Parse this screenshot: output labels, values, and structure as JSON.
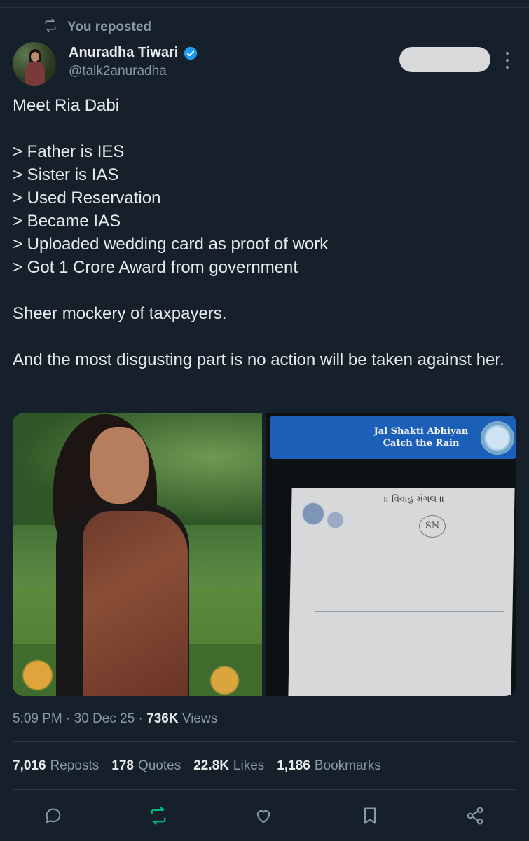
{
  "repost": {
    "label": "You reposted",
    "icon": "repost-icon"
  },
  "author": {
    "name": "Anuradha Tiwari",
    "handle": "@talk2anuradha",
    "verified": true,
    "badge_color": "#1d9bf0"
  },
  "tweet": {
    "paragraphs": [
      [
        "Meet Ria Dabi"
      ],
      [
        "> Father is IES",
        "> Sister is IAS",
        "> Used Reservation",
        "> Became IAS",
        "> Uploaded wedding card as proof of work",
        "> Got 1 Crore Award from government"
      ],
      [
        "Sheer mockery of taxpayers."
      ],
      [
        "And the most disgusting part is no action will be taken against her."
      ]
    ]
  },
  "media": {
    "right_banner_line1": "Jal Shakti Abhiyan",
    "right_banner_line2": "Catch the Rain",
    "card_title": "॥ વિવાહ મંગલ ॥",
    "card_monogram": "SN"
  },
  "meta": {
    "time": "5:09 PM",
    "date": "30 Dec 25",
    "views_count": "736K",
    "views_label": "Views"
  },
  "stats": [
    {
      "count": "7,016",
      "label": "Reposts"
    },
    {
      "count": "178",
      "label": "Quotes"
    },
    {
      "count": "22.8K",
      "label": "Likes"
    },
    {
      "count": "1,186",
      "label": "Bookmarks"
    }
  ],
  "actions": [
    "reply-icon",
    "repost-icon",
    "like-icon",
    "bookmark-icon",
    "share-icon"
  ],
  "colors": {
    "background": "#15202b",
    "text": "#e7e9ea",
    "muted": "#8b98a5",
    "repost_active": "#00ba7c"
  }
}
